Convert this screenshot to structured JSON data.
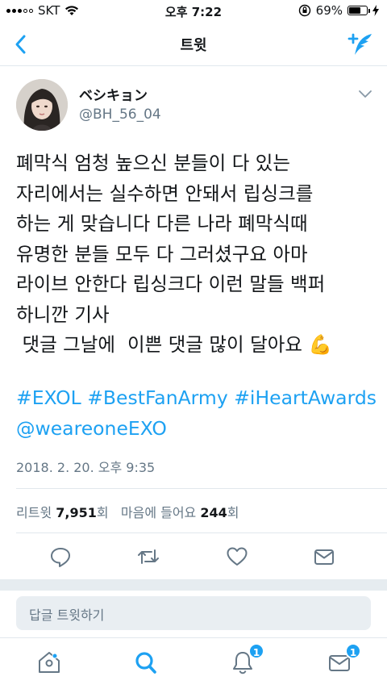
{
  "status_bar": {
    "carrier": "SKT",
    "time": "오후 7:22",
    "battery_percent": "69%",
    "battery_level": 0.69
  },
  "nav": {
    "title": "트윗",
    "back_icon": "chevron-left-icon",
    "compose_icon": "compose-tweet-icon"
  },
  "tweet": {
    "display_name": "ベシキョン",
    "handle": "@BH_56_04",
    "lines": [
      "폐막식 엄청  높으신 분들이 다 있는",
      "자리에서는 실수하면 안돼서 립싱크를",
      "하는 게 맞습니다 다른 나라 폐막식때",
      "유명한 분들 모두 다 그러셨구요 아마",
      "라이브 안한다 립싱크다 이런 말들 백퍼",
      "하니깐 기사",
      " 댓글 그날에  이쁜 댓글 많이 달아요 💪"
    ],
    "hashtags": [
      "#EXOL",
      "#BestFanArmy",
      "#iHeartAwards"
    ],
    "mention": "@weareoneEXO",
    "timestamp": "2018. 2. 20. 오후 9:35",
    "retweets_label": "리트윗",
    "retweets_count": "7,951",
    "retweets_unit": "회",
    "likes_label": "마음에 들어요",
    "likes_count": "244",
    "likes_unit": "회"
  },
  "actions": [
    "reply-icon",
    "retweet-icon",
    "like-icon",
    "direct-message-icon"
  ],
  "reply": {
    "placeholder": "답글 트윗하기"
  },
  "tabs": [
    {
      "name": "home-icon",
      "badge": ""
    },
    {
      "name": "search-icon",
      "badge": ""
    },
    {
      "name": "notifications-icon",
      "badge": "1"
    },
    {
      "name": "messages-icon",
      "badge": "1"
    }
  ],
  "colors": {
    "accent": "#1da1f2",
    "secondary_text": "#657786",
    "border": "#e1e8ed"
  }
}
